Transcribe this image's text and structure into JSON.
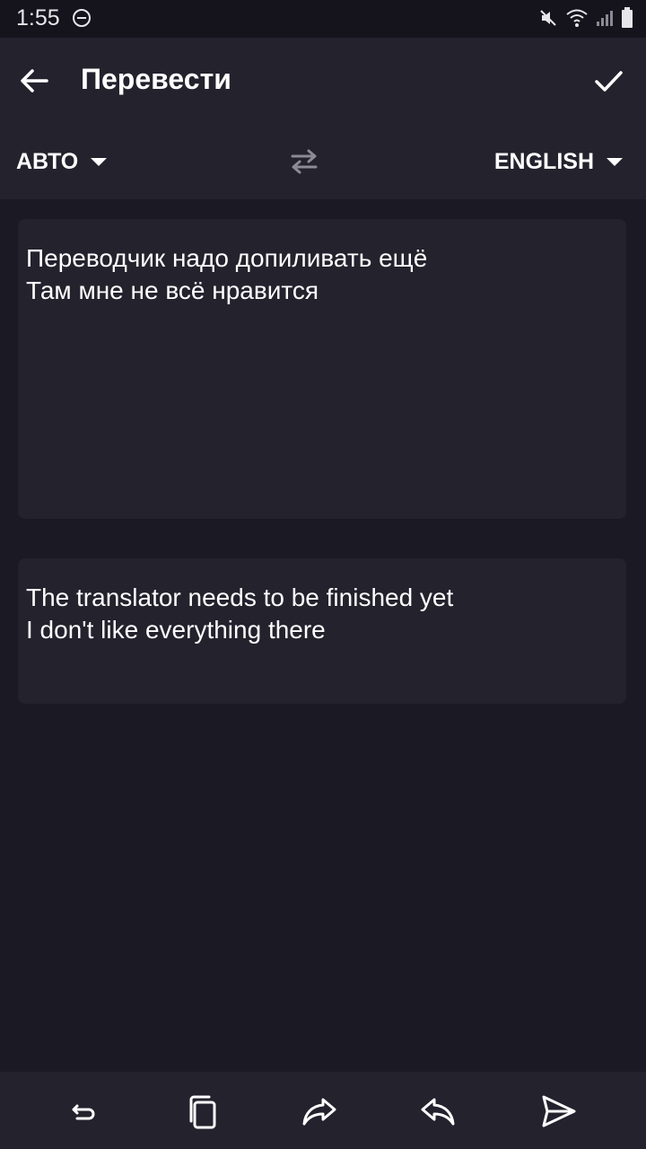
{
  "status_bar": {
    "time": "1:55",
    "icons": [
      "do-not-disturb-icon",
      "mute-icon",
      "wifi-icon",
      "signal-icon",
      "battery-icon"
    ]
  },
  "app_bar": {
    "title": "Перевести",
    "back_icon": "arrow-left-icon",
    "confirm_icon": "check-icon"
  },
  "languages": {
    "from": "АВТО",
    "to": "ENGLISH",
    "swap_icon": "swap-arrows-icon"
  },
  "source": {
    "text": "Переводчик надо допиливать ещё\nТам мне не всё нравится"
  },
  "translation": {
    "text": "The translator needs to be finished yet\nI don't like everything there"
  },
  "bottom_bar": {
    "icons": [
      "undo-icon",
      "copy-icon",
      "forward-icon",
      "reply-icon",
      "send-icon"
    ]
  },
  "colors": {
    "background": "#1b1a24",
    "surface": "#23222d",
    "text": "#ffffff"
  }
}
